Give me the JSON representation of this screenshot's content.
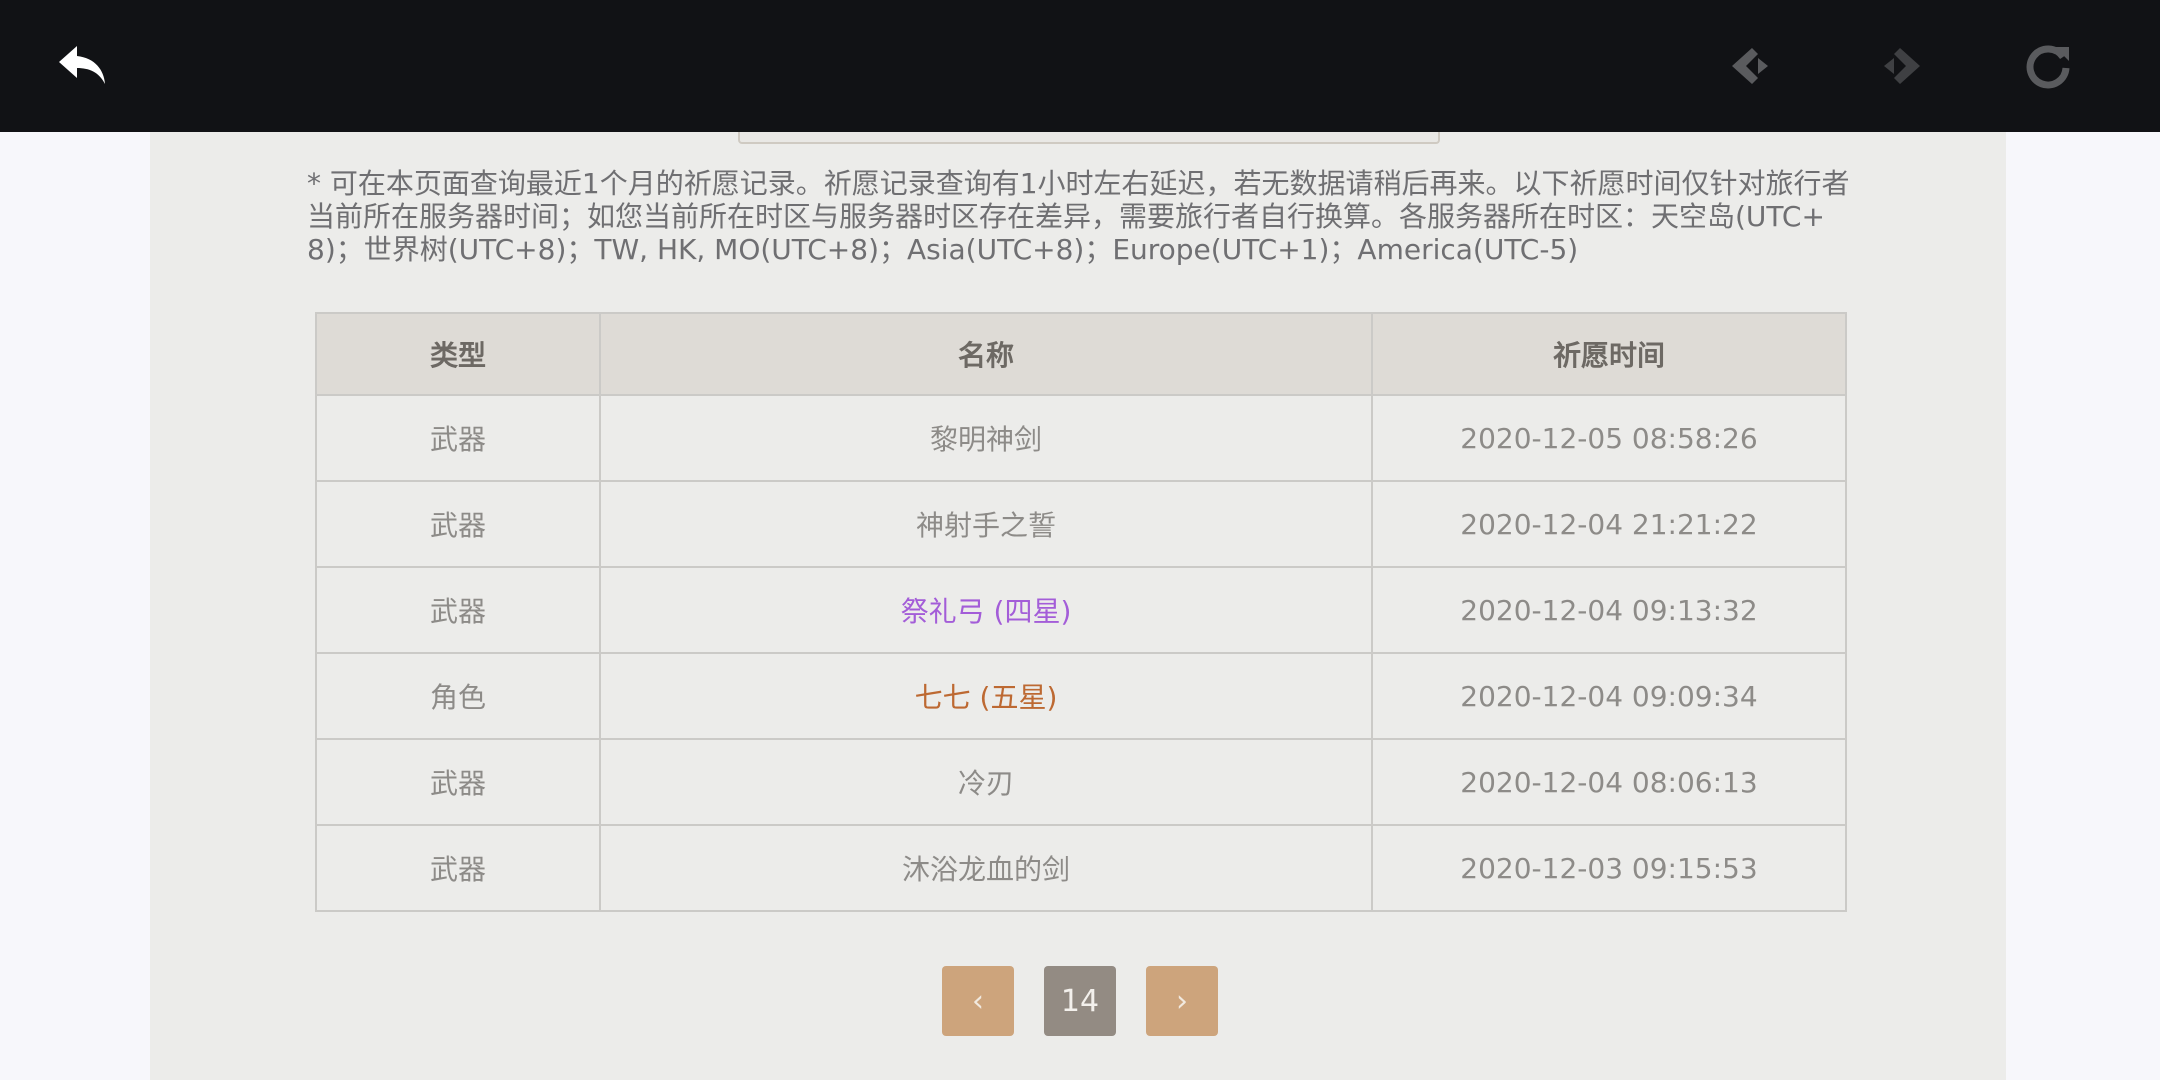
{
  "toolbar": {
    "icons": [
      "back-icon",
      "prev-icon",
      "next-icon",
      "reload-icon"
    ]
  },
  "notice": "* 可在本页面查询最近1个月的祈愿记录。祈愿记录查询有1小时左右延迟，若无数据请稍后再来。以下祈愿时间仅针对旅行者当前所在服务器时间；如您当前所在时区与服务器时区存在差异，需要旅行者自行换算。各服务器所在时区：天空岛(UTC+8)；世界树(UTC+8)；TW, HK, MO(UTC+8)；Asia(UTC+8)；Europe(UTC+1)；America(UTC-5)",
  "table": {
    "headers": [
      "类型",
      "名称",
      "祈愿时间"
    ],
    "rows": [
      {
        "type": "武器",
        "name": "黎明神剑",
        "time": "2020-12-05 08:58:26"
      },
      {
        "type": "武器",
        "name": "神射手之誓",
        "time": "2020-12-04 21:21:22"
      },
      {
        "type": "武器",
        "name": "祭礼弓 (四星)",
        "time": "2020-12-04 09:13:32"
      },
      {
        "type": "角色",
        "name": "七七 (五星)",
        "time": "2020-12-04 09:09:34"
      },
      {
        "type": "武器",
        "name": "冷刃",
        "time": "2020-12-04 08:06:13"
      },
      {
        "type": "武器",
        "name": "沐浴龙血的剑",
        "time": "2020-12-03 09:15:53"
      }
    ]
  },
  "pagination": {
    "prev": "‹",
    "current": "14",
    "next": "›"
  },
  "colors": {
    "four_star": "#a35dd8",
    "five_star": "#bd6932",
    "toolbar_bg": "#111215"
  }
}
